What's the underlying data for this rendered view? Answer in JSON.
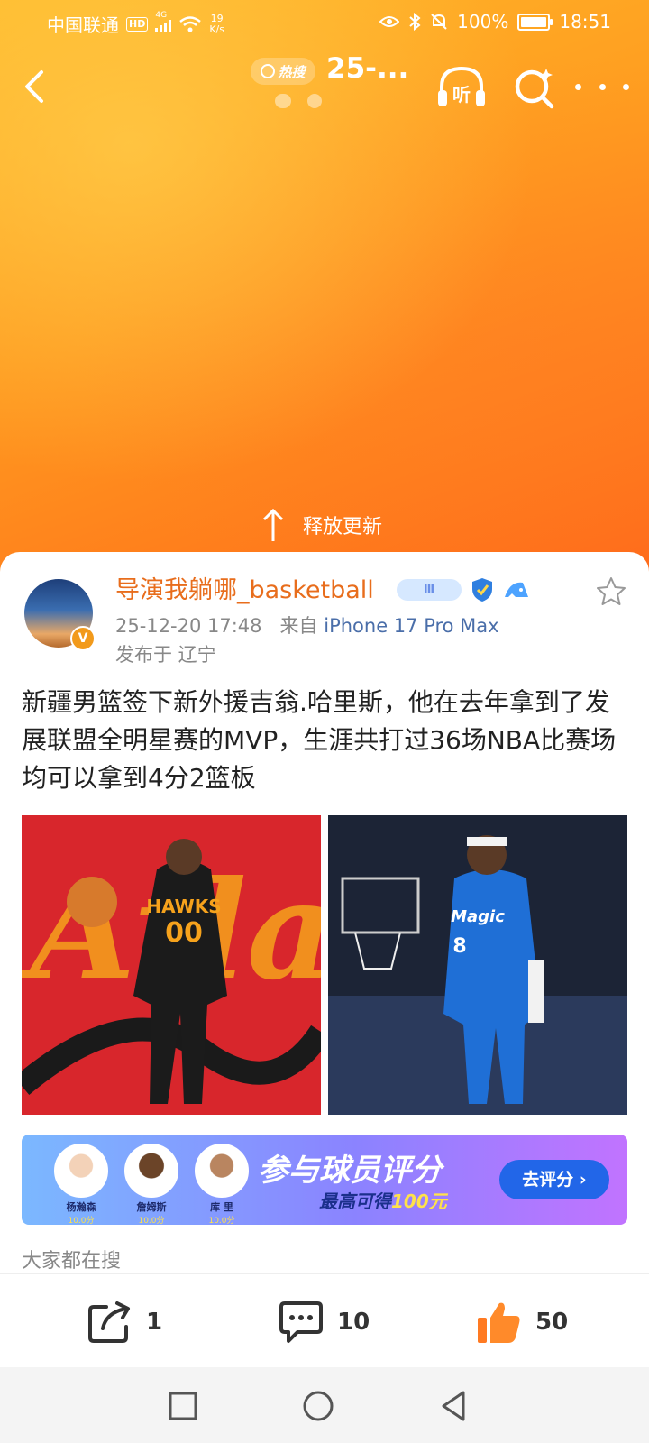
{
  "status_bar": {
    "carrier": "中国联通",
    "hd": "HD",
    "network": "4G",
    "net_speed_value": "19",
    "net_speed_unit": "K/s",
    "battery": "100%",
    "time": "18:51"
  },
  "nav": {
    "hot_search_label": "热搜",
    "title": "25-...",
    "listen_label": "听"
  },
  "pull_refresh": {
    "label": "释放更新"
  },
  "post": {
    "username": "导演我躺哪_basketball",
    "level_badge": "Ⅲ",
    "verified_badge": "V",
    "datetime": "25-12-20 17:48",
    "source_prefix": "来自",
    "source_device": "iPhone 17 Pro Max",
    "location": "发布于 辽宁",
    "text": "新疆男篮签下新外援吉翁.哈里斯，他在去年拿到了发展联盟全明星赛的MVP，生涯共打过36场NBA比赛场均可以拿到4分2篮板",
    "images": [
      {
        "team_text": "HAWKS",
        "number": "00",
        "bg_text": "Atlanta"
      },
      {
        "team_text": "Magic",
        "number": "8"
      }
    ]
  },
  "promo_banner": {
    "players": [
      {
        "name": "杨瀚森",
        "score": "10.0分"
      },
      {
        "name": "詹姆斯",
        "score": "10.0分"
      },
      {
        "name": "库 里",
        "score": "10.0分"
      }
    ],
    "title": "参与球员评分",
    "subtitle_prefix": "最高可得",
    "subtitle_highlight": "100元",
    "button_label": "去评分 ›"
  },
  "section": {
    "also_search_label": "大家都在搜"
  },
  "action_bar": {
    "share_count": "1",
    "comment_count": "10",
    "like_count": "50"
  },
  "colors": {
    "accent_orange": "#ff8a1f",
    "username_orange": "#e86d1c",
    "link_blue": "#4a6ea9",
    "rate_button_blue": "#2266e8"
  }
}
